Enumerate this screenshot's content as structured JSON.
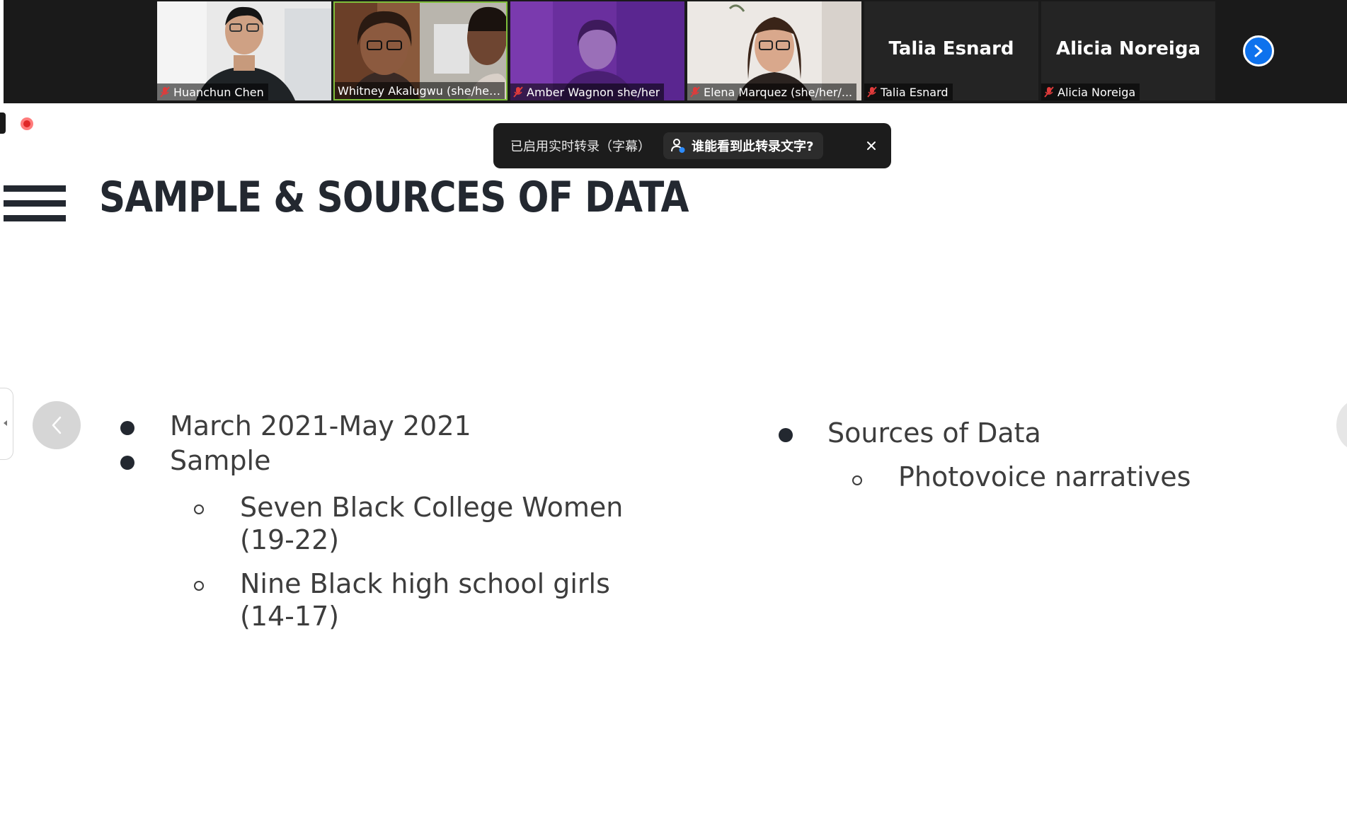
{
  "participants": [
    {
      "name": "Huanchun Chen",
      "muted": true,
      "video": true
    },
    {
      "name": "Whitney Akalugwu (she/her)...",
      "muted": false,
      "video": true,
      "active_speaker": true
    },
    {
      "name": "Amber Wagnon she/her",
      "muted": true,
      "video": true
    },
    {
      "name": "Elena Marquez (she/her/...",
      "muted": true,
      "video": true
    },
    {
      "name": "Talia Esnard",
      "muted": true,
      "video": false,
      "display_name": "Talia Esnard"
    },
    {
      "name": "Alicia Noreiga",
      "muted": true,
      "video": false,
      "display_name": "Alicia Noreiga"
    }
  ],
  "toast": {
    "message": "已启用实时转录（字幕）",
    "link_label": "谁能看到此转录文字?",
    "close_icon": "close-icon"
  },
  "slide": {
    "title": "SAMPLE & SOURCES OF DATA",
    "left_column": {
      "items": [
        {
          "text": "March 2021-May 2021"
        },
        {
          "text": "Sample"
        }
      ],
      "sub_items": [
        {
          "line1": "Seven Black College Women",
          "line2": "(19-22)"
        },
        {
          "line1": "Nine Black high school girls",
          "line2": "(14-17)"
        }
      ]
    },
    "right_column": {
      "item": "Sources of Data",
      "sub_item": "Photovoice narratives"
    }
  },
  "colors": {
    "strip_bg": "#1a1a1a",
    "active_border": "#7fbf3a",
    "next_button": "#0e72ed",
    "title": "#232830",
    "record": "#e02828"
  }
}
